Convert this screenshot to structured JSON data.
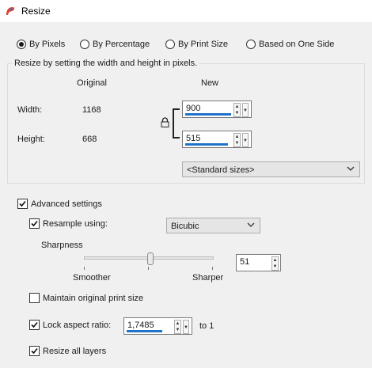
{
  "window": {
    "title": "Resize"
  },
  "resize_mode": {
    "options": [
      "By Pixels",
      "By Percentage",
      "By Print Size",
      "Based on One Side"
    ],
    "selected": "By Pixels"
  },
  "pixel_group": {
    "caption": "Resize by setting the width and height in pixels.",
    "original_header": "Original",
    "new_header": "New",
    "width_label": "Width:",
    "height_label": "Height:",
    "original_width": "1168",
    "original_height": "668",
    "new_width": "900",
    "new_height": "515",
    "standard_sizes": "<Standard sizes>"
  },
  "advanced": {
    "label": "Advanced settings",
    "checked": true,
    "resample_label": "Resample using:",
    "resample_checked": true,
    "resample_method": "Bicubic",
    "sharpness_label": "Sharpness",
    "sharpness_min_label": "Smoother",
    "sharpness_max_label": "Sharper",
    "sharpness_value": "51",
    "sharpness_level": 0.51,
    "maintain_print_label": "Maintain original print size",
    "maintain_print_checked": false,
    "lock_aspect_label": "Lock aspect ratio:",
    "lock_aspect_checked": true,
    "aspect_value": "1,7485",
    "aspect_suffix": "to 1",
    "resize_all_layers_label": "Resize all layers",
    "resize_all_layers_checked": true
  },
  "colors": {
    "accent": "#1e73c8"
  }
}
